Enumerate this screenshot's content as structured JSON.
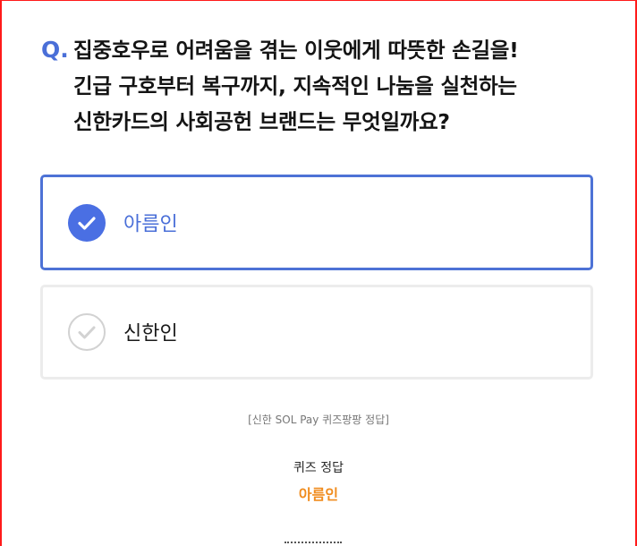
{
  "question": {
    "prefix": "Q.",
    "lines": [
      "집중호우로 어려움을 겪는 이웃에게 따뜻한 손길을!",
      "긴급 구호부터 복구까지, 지속적인 나눔을 실천하는",
      "신한카드의 사회공헌 브랜드는 무엇일까요?"
    ]
  },
  "options": [
    {
      "label": "아름인",
      "selected": true
    },
    {
      "label": "신한인",
      "selected": false
    }
  ],
  "answer": {
    "caption": "[신한 SOL Pay 퀴즈팡팡 정답]",
    "heading": "퀴즈 정답",
    "value": "아름인"
  },
  "colors": {
    "accent": "#4a6fd8",
    "answer": "#f08c1e",
    "frame": "#ff1a1a"
  }
}
